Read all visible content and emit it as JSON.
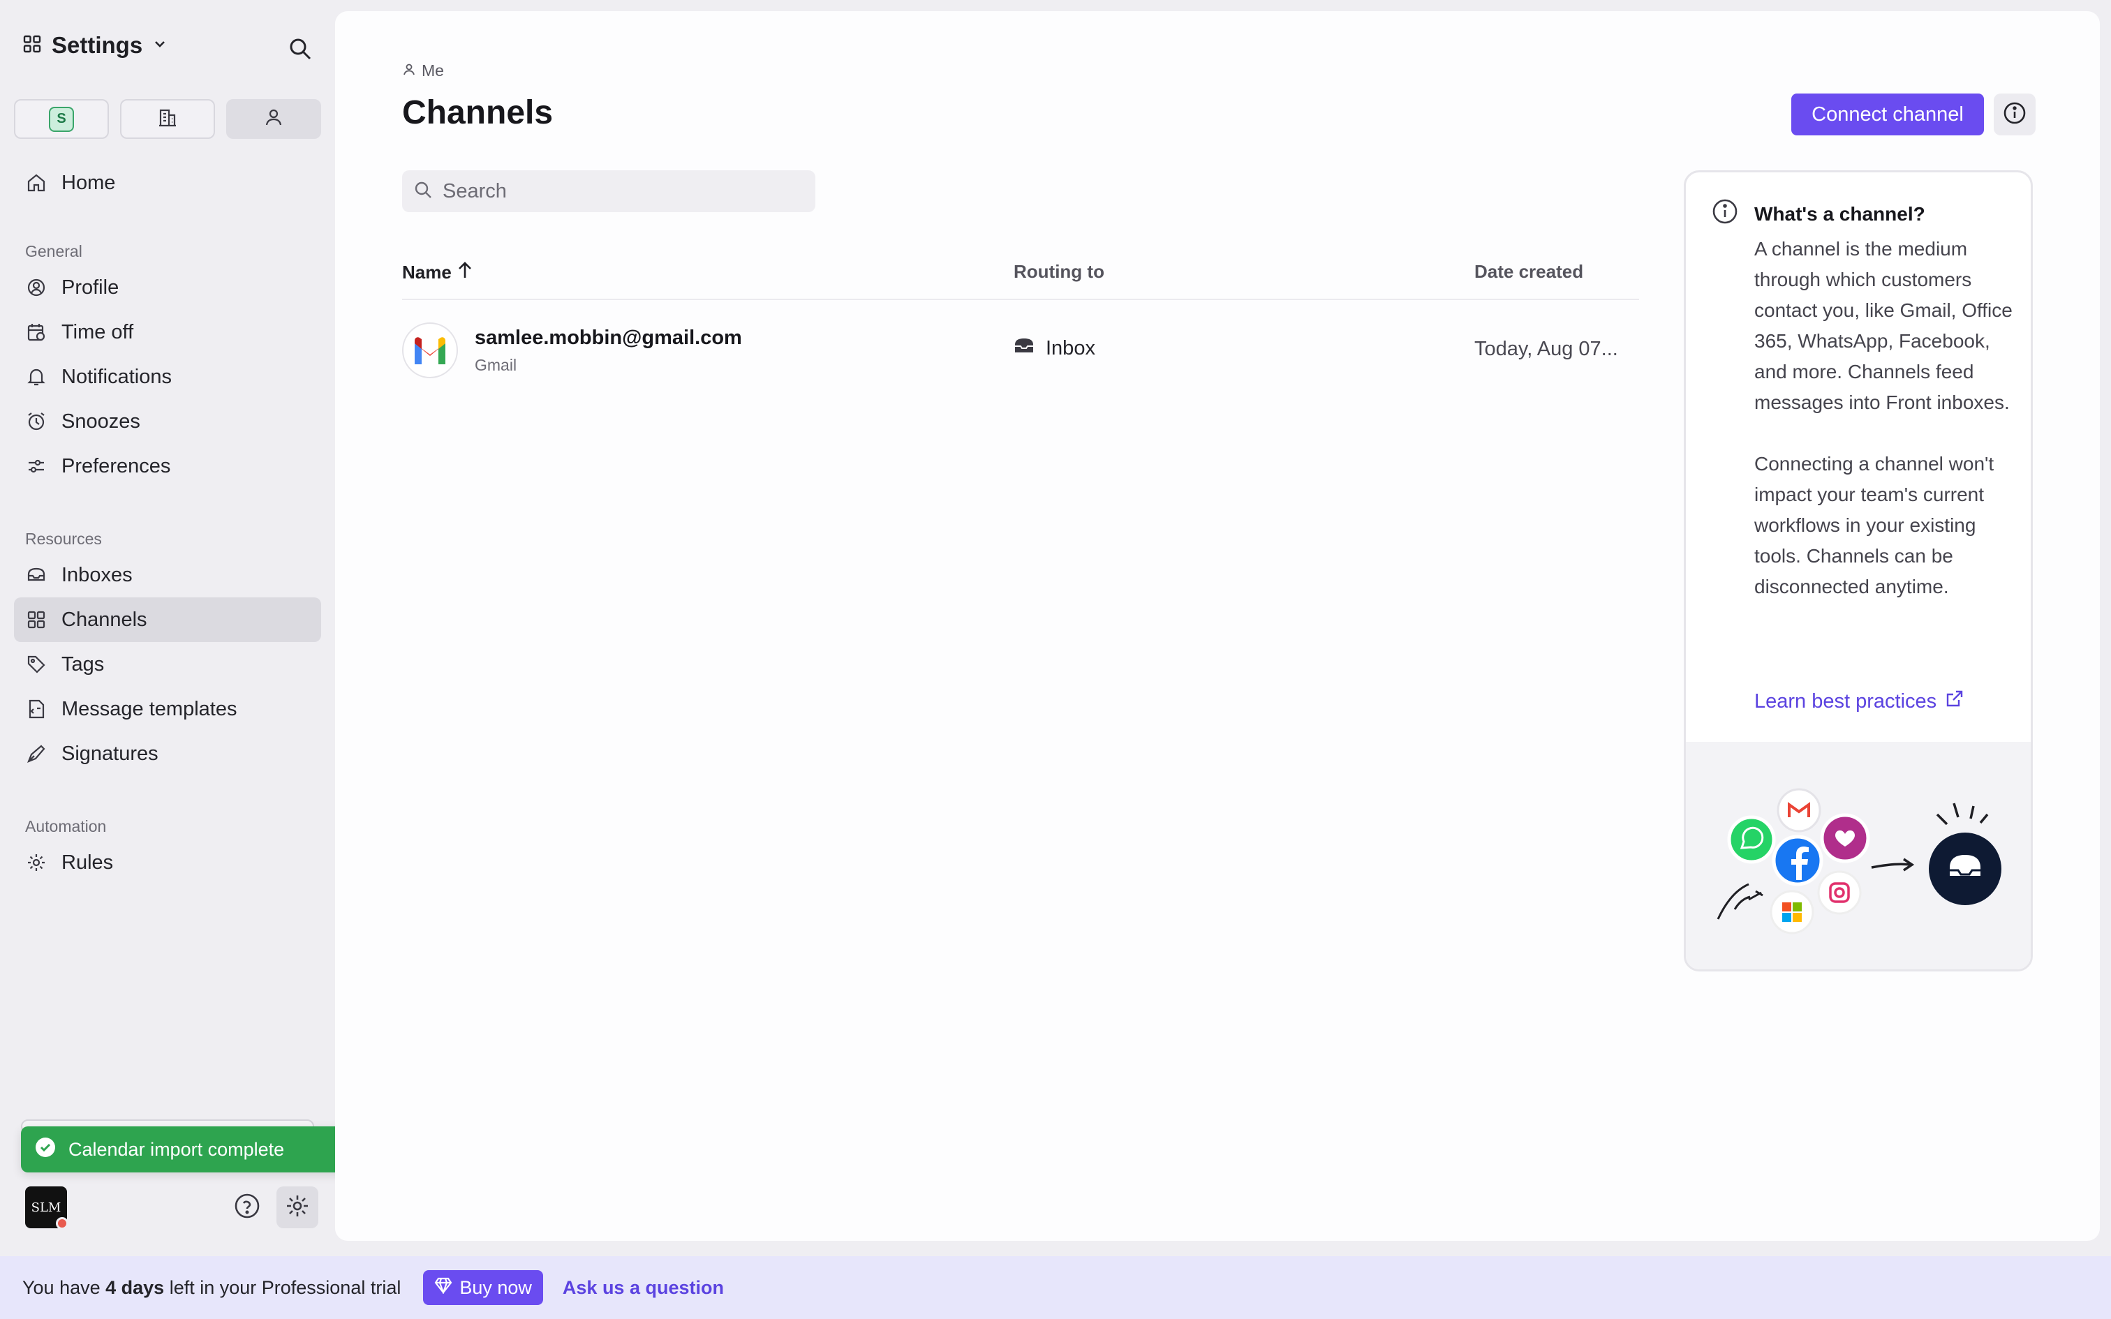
{
  "sidebar": {
    "title": "Settings",
    "scope_tabs": [
      {
        "name": "workspace",
        "chip": "S"
      },
      {
        "name": "company"
      },
      {
        "name": "personal"
      }
    ],
    "home": "Home",
    "sections": {
      "general": "General",
      "resources": "Resources",
      "automation": "Automation"
    },
    "general_items": [
      "Profile",
      "Time off",
      "Notifications",
      "Snoozes",
      "Preferences"
    ],
    "resource_items": [
      "Inboxes",
      "Channels",
      "Tags",
      "Message templates",
      "Signatures"
    ],
    "automation_items": [
      "Rules"
    ],
    "active_item": "Channels",
    "avatar_initials": "SLM"
  },
  "toast": {
    "text": "Calendar import complete",
    "color": "#2ea44f"
  },
  "main": {
    "breadcrumb": "Me",
    "title": "Channels",
    "connect_button": "Connect channel",
    "search_placeholder": "Search",
    "table": {
      "columns": {
        "name": "Name",
        "routing": "Routing to",
        "date": "Date created"
      },
      "sort": "Name ascending",
      "rows": [
        {
          "email": "samlee.mobbin@gmail.com",
          "type": "Gmail",
          "routing": "Inbox",
          "date": "Today, Aug 07..."
        }
      ]
    },
    "info_card": {
      "heading": "What's a channel?",
      "paragraph1": "A channel is the medium through which customers contact you, like Gmail, Office 365, WhatsApp, Facebook, and more. Channels feed messages into Front inboxes.",
      "paragraph2": "Connecting a channel won't impact your team's current workflows in your existing tools. Channels can be disconnected anytime.",
      "link": "Learn best practices"
    }
  },
  "trial_bar": {
    "prefix": "You have ",
    "days": "4 days",
    "suffix": " left in your Professional trial",
    "buy_button": "Buy now",
    "ask_link": "Ask us a question"
  },
  "colors": {
    "accent": "#6a4cf0",
    "link": "#5b43e0",
    "sidebar_bg": "#efeef2",
    "trial_bg": "#e7e6fb"
  }
}
